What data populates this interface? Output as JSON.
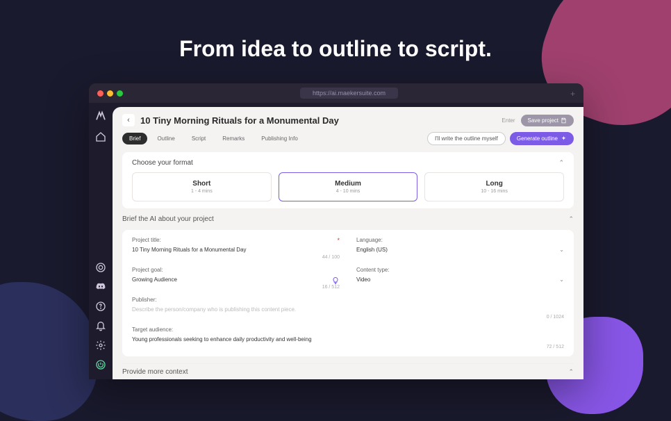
{
  "heading": "From idea to outline to script.",
  "browser": {
    "url": "https://ai.maekersuite.com"
  },
  "project": {
    "title": "10 Tiny Morning Rituals for a Monumental Day",
    "enter_hint": "Enter",
    "save_label": "Save project"
  },
  "tabs": {
    "items": [
      "Brief",
      "Outline",
      "Script",
      "Remarks",
      "Publishing Info"
    ],
    "active": 0,
    "write_outline_myself": "I'll write the outline myself",
    "generate_outline": "Generate outline"
  },
  "format": {
    "title": "Choose your format",
    "options": [
      {
        "name": "Short",
        "duration": "1 - 4 mins"
      },
      {
        "name": "Medium",
        "duration": "4 - 10 mins"
      },
      {
        "name": "Long",
        "duration": "10 - 16 mins"
      }
    ],
    "selected": 1
  },
  "brief": {
    "section_title": "Brief the AI about your project",
    "project_title_label": "Project title:",
    "project_title_value": "10 Tiny Morning Rituals for a Monumental Day",
    "project_title_count": "44 / 100",
    "language_label": "Language:",
    "language_value": "English (US)",
    "project_goal_label": "Project goal:",
    "project_goal_value": "Growing Audience",
    "project_goal_count": "16 / 512",
    "content_type_label": "Content type:",
    "content_type_value": "Video",
    "publisher_label": "Publisher:",
    "publisher_placeholder": "Describe the person/company who is publishing this content piece.",
    "publisher_count": "0 / 1024",
    "audience_label": "Target audience:",
    "audience_value": "Young professionals seeking to enhance daily productivity and well-being",
    "audience_count": "72 / 512"
  },
  "more_context": {
    "title": "Provide more context"
  }
}
